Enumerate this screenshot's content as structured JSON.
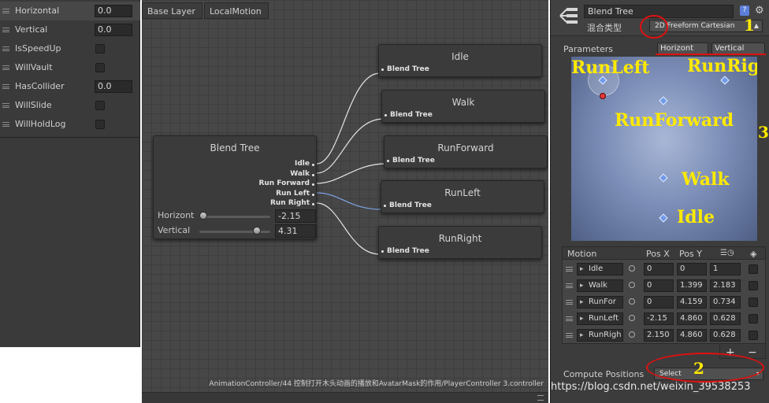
{
  "parameters": [
    {
      "name": "Horizontal",
      "type": "float",
      "value": "0.0"
    },
    {
      "name": "Vertical",
      "type": "float",
      "value": "0.0"
    },
    {
      "name": "IsSpeedUp",
      "type": "bool"
    },
    {
      "name": "WillVault",
      "type": "bool"
    },
    {
      "name": "HasCollider",
      "type": "float",
      "value": "0.0"
    },
    {
      "name": "WillSlide",
      "type": "bool"
    },
    {
      "name": "WillHoldLog",
      "type": "bool"
    }
  ],
  "breadcrumb": [
    "Base Layer",
    "LocalMotion"
  ],
  "graph": {
    "blend_tree_node": {
      "title": "Blend Tree",
      "outputs": [
        "Idle",
        "Walk",
        "Run Forward",
        "Run Left",
        "Run Right"
      ],
      "horizontal_label": "Horizont",
      "horizontal_value": "-2.15",
      "horizontal_level": 0.0,
      "vertical_label": "Vertical",
      "vertical_value": "4.31",
      "vertical_level": 0.85
    },
    "child_nodes": [
      {
        "title": "Idle",
        "port": "Blend Tree"
      },
      {
        "title": "Walk",
        "port": "Blend Tree"
      },
      {
        "title": "RunForward",
        "port": "Blend Tree"
      },
      {
        "title": "RunLeft",
        "port": "Blend Tree"
      },
      {
        "title": "RunRight",
        "port": "Blend Tree"
      }
    ],
    "asset_path": "AnimationController/44 控制打开木头动画的播放和AvatarMask的作用/PlayerController 3.controller"
  },
  "inspector": {
    "name": "Blend Tree",
    "blend_type_label": "混合类型",
    "blend_type_value": "2D Freeform Cartesian",
    "parameters_label": "Parameters",
    "param_x": "Horizont",
    "param_y": "Vertical",
    "blend_labels": [
      "RunLeft",
      "RunRigh",
      "RunForward",
      "Walk",
      "Idle"
    ],
    "motion_table": {
      "headers": [
        "Motion",
        "Pos X",
        "Pos Y"
      ],
      "rows": [
        {
          "motion": "Idle",
          "pos_x": "0",
          "pos_y": "0",
          "speed": "1"
        },
        {
          "motion": "Walk",
          "pos_x": "0",
          "pos_y": "1.399",
          "speed": "2.183"
        },
        {
          "motion": "RunFor",
          "pos_x": "0",
          "pos_y": "4.159",
          "speed": "0.734"
        },
        {
          "motion": "RunLeft",
          "pos_x": "-2.15",
          "pos_y": "4.860",
          "speed": "0.628"
        },
        {
          "motion": "RunRigh",
          "pos_x": "2.150",
          "pos_y": "4.860",
          "speed": "0.628"
        }
      ]
    },
    "add_label": "+",
    "remove_label": "−",
    "compute_label": "Compute Positions",
    "compute_value": "Select",
    "watermark": "https://blog.csdn.net/weixin_39538253"
  },
  "annotations": [
    "1",
    "2",
    "3"
  ],
  "colors": {
    "annotation_yellow": "#ffea00",
    "annotation_red": "#e01010",
    "panel_bg": "#3c3c3c",
    "graph_bg": "#474747",
    "blend_point": "#6f9be8"
  },
  "icons": [
    "blend-tree-icon",
    "help-icon",
    "gear-icon",
    "dropdown-arrow-icon",
    "speed-icon",
    "mirror-icon"
  ]
}
